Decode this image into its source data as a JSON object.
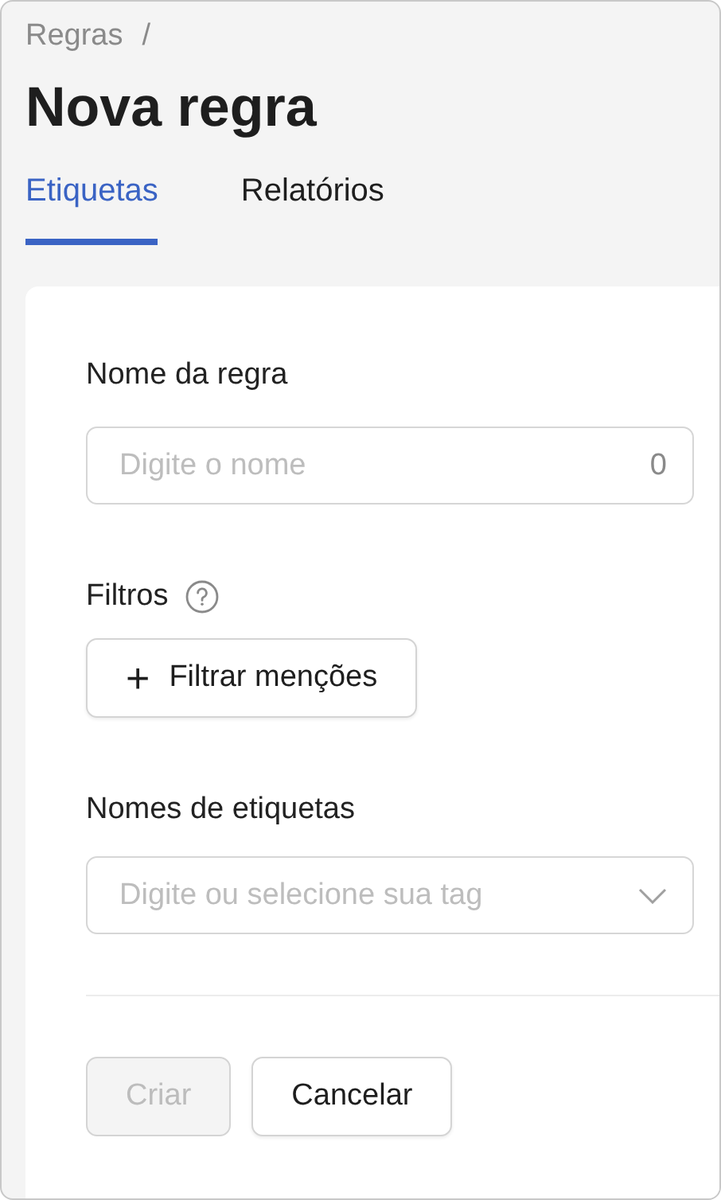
{
  "breadcrumb": {
    "items": [
      "Regras"
    ],
    "separator": "/"
  },
  "title": "Nova regra",
  "tabs": [
    {
      "label": "Etiquetas",
      "selected": true
    },
    {
      "label": "Relatórios",
      "selected": false
    }
  ],
  "form": {
    "name_field": {
      "label": "Nome da regra",
      "placeholder": "Digite o nome",
      "counter": "0"
    },
    "filters": {
      "label": "Filtros",
      "help": true,
      "button": {
        "icon": "+",
        "label": "Filtrar menções"
      }
    },
    "tags_field": {
      "label": "Nomes de etiquetas",
      "placeholder": "Digite ou selecione sua tag"
    },
    "buttons": [
      {
        "label": "Criar",
        "disabled": true
      },
      {
        "label": "Cancelar",
        "disabled": false
      }
    ]
  }
}
